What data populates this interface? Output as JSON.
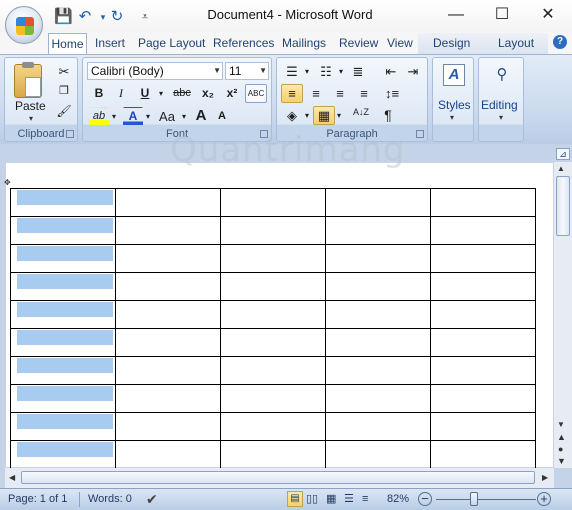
{
  "window": {
    "title": "Document4 - Microsoft Word",
    "min": "—",
    "max": "☐",
    "close": "✕"
  },
  "qat": {
    "save": "💾",
    "undo": "↶",
    "redo": "↻",
    "customize": "⩡"
  },
  "tabs": [
    "Home",
    "Insert",
    "Page Layout",
    "References",
    "Mailings",
    "Review",
    "View"
  ],
  "context_tabs": [
    "Design",
    "Layout"
  ],
  "help": "?",
  "ribbon": {
    "clipboard": {
      "name": "Clipboard",
      "paste": "Paste"
    },
    "font": {
      "name": "Font",
      "family": "Calibri (Body)",
      "size": "11",
      "bold": "B",
      "italic": "I",
      "underline": "U",
      "strike": "abc",
      "sub": "x₂",
      "sup": "x²",
      "grow": "A",
      "shrink": "A",
      "case": "Aa",
      "clear": "ABC",
      "highlight": "ab",
      "color": "A"
    },
    "paragraph": {
      "name": "Paragraph",
      "pilcrow": "¶",
      "sort": "A↓Z"
    },
    "styles": {
      "name": "Styles"
    },
    "editing": {
      "name": "Editing"
    }
  },
  "watermark": "Quantrimang",
  "table": {
    "rows": 10,
    "cols": 5
  },
  "status": {
    "page": "Page: 1 of 1",
    "words": "Words: 0",
    "zoom": "82%"
  },
  "colors": {
    "accent": "#15428b",
    "ribbon": "#c6d6ec",
    "shade": "#a8ccf0",
    "selected": "#f8cf6c"
  }
}
